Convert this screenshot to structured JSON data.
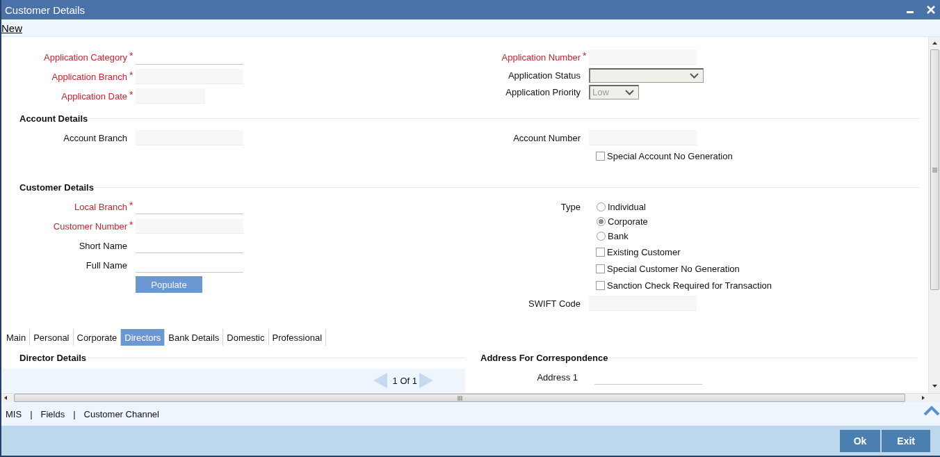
{
  "window": {
    "title": "Customer Details"
  },
  "toolbar": {
    "new_link": "New"
  },
  "required_symbol": "*",
  "application": {
    "left": [
      {
        "kind": "line",
        "label": "Application Category",
        "required": true
      },
      {
        "kind": "shaded",
        "label": "Application Branch",
        "required": true
      },
      {
        "kind": "shaded",
        "label": "Application Date",
        "required": true,
        "short": true
      }
    ],
    "right": [
      {
        "kind": "shaded",
        "label": "Application Number",
        "required": true
      },
      {
        "kind": "select",
        "label": "Application Status",
        "required": false,
        "disabled": true
      },
      {
        "kind": "select",
        "label": "Application Priority",
        "required": false,
        "disabled": true,
        "short": true,
        "value": "Low"
      }
    ]
  },
  "account_details": {
    "title": "Account Details",
    "left": [
      {
        "kind": "shaded",
        "label": "Account Branch",
        "required": false
      }
    ],
    "right": [
      {
        "kind": "shaded",
        "label": "Account Number",
        "required": false
      },
      {
        "kind": "checkbox",
        "label": "Special Account No Generation",
        "checked": false
      }
    ]
  },
  "customer_details": {
    "title": "Customer Details",
    "left": [
      {
        "kind": "line",
        "label": "Local Branch",
        "required": true
      },
      {
        "kind": "shaded",
        "label": "Customer Number",
        "required": true
      },
      {
        "kind": "line",
        "label": "Short Name",
        "required": false
      },
      {
        "kind": "line",
        "label": "Full Name",
        "required": false
      },
      {
        "kind": "button",
        "label": "Populate"
      }
    ],
    "right": [
      {
        "kind": "radio_group",
        "label": "Type",
        "options": [
          {
            "label": "Individual",
            "selected": false
          },
          {
            "label": "Corporate",
            "selected": true
          },
          {
            "label": "Bank",
            "selected": false
          }
        ]
      },
      {
        "kind": "checkbox",
        "label": "Existing Customer",
        "checked": false
      },
      {
        "kind": "checkbox",
        "label": "Special Customer No Generation",
        "checked": false
      },
      {
        "kind": "checkbox",
        "label": "Sanction Check Required for Transaction",
        "checked": false
      },
      {
        "kind": "shaded",
        "label": "SWIFT Code",
        "required": false
      }
    ]
  },
  "tabs": [
    {
      "label": "Main",
      "selected": false
    },
    {
      "label": "Personal",
      "selected": false
    },
    {
      "label": "Corporate",
      "selected": false
    },
    {
      "label": "Directors",
      "selected": true
    },
    {
      "label": "Bank Details",
      "selected": false
    },
    {
      "label": "Domestic",
      "selected": false
    },
    {
      "label": "Professional",
      "selected": false
    }
  ],
  "director_details": {
    "title": "Director Details",
    "pager": "1 Of 1"
  },
  "address": {
    "title": "Address For Correspondence",
    "fields": [
      {
        "kind": "line",
        "label": "Address 1"
      }
    ]
  },
  "footer": {
    "links": [
      "MIS",
      "Fields",
      "Customer Channel"
    ],
    "separator": "|"
  },
  "buttons": [
    "Ok",
    "Exit"
  ]
}
